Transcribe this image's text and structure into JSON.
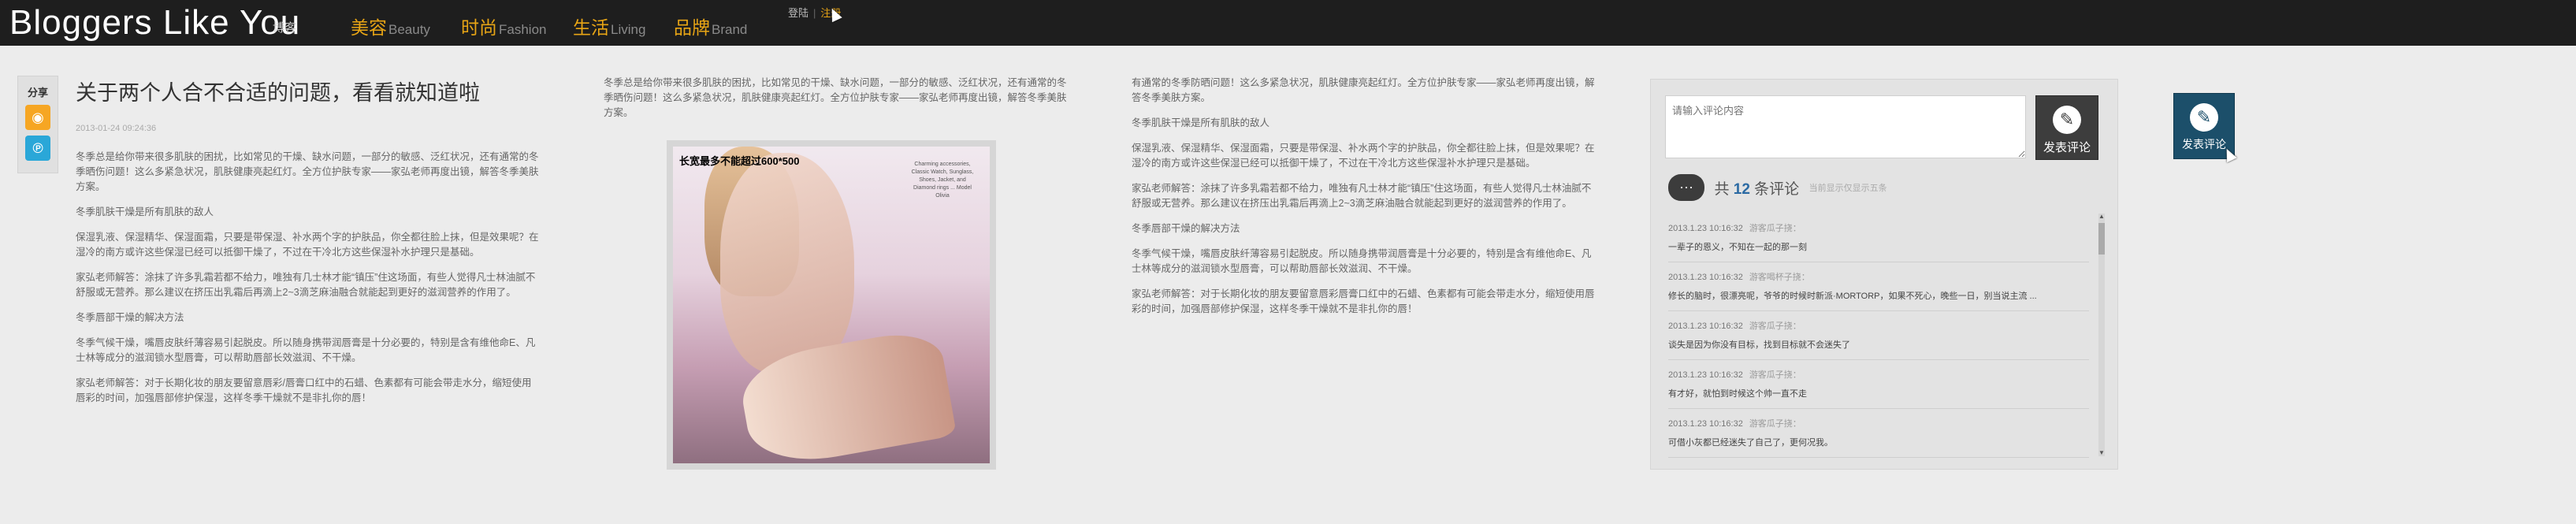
{
  "header": {
    "logo": "Bloggers Like You",
    "logo_cn": "博客",
    "nav": [
      {
        "cn": "美容",
        "en": "Beauty"
      },
      {
        "cn": "时尚",
        "en": "Fashion"
      },
      {
        "cn": "生活",
        "en": "Living"
      },
      {
        "cn": "品牌",
        "en": "Brand"
      }
    ],
    "login": "登陆",
    "register": "注册"
  },
  "share": {
    "label": "分享",
    "icons": [
      "weibo-icon",
      "tencent-icon"
    ]
  },
  "article": {
    "title": "关于两个人合不合适的问题，看看就知道啦",
    "date": "2013-01-24 09:24:36",
    "col1": [
      "冬季总是给你带来很多肌肤的困扰，比如常见的干燥、缺水问题，一部分的敏感、泛红状况，还有通常的冬季晒伤问题！这么多紧急状况，肌肤健康亮起红灯。全方位护肤专家——家弘老师再度出镜，解答冬季美肤方案。",
      "冬季肌肤干燥是所有肌肤的敌人",
      "保湿乳液、保湿精华、保湿面霜，只要是带保湿、补水两个字的护肤品，你全都往脸上抹，但是效果呢？在湿冷的南方或许这些保湿已经可以抵御干燥了，不过在干冷北方这些保湿补水护理只是基础。",
      "家弘老师解答：涂抹了许多乳霜若都不给力，唯独有几士林才能“镇压”住这场面，有些人觉得凡士林油腻不舒服或无营养。那么建议在挤压出乳霜后再滴上2~3滴芝麻油融合就能起到更好的滋润营养的作用了。",
      "冬季唇部干燥的解决方法",
      "冬季气候干燥，嘴唇皮肤纤薄容易引起脱皮。所以随身携带润唇膏是十分必要的，特别是含有维他命E、凡士林等成分的滋润锁水型唇膏，可以帮助唇部长效滋润、不干燥。",
      "家弘老师解答：对于长期化妆的朋友要留意唇彩/唇膏口红中的石蜡、色素都有可能会带走水分，缩短使用唇彩的时间，加强唇部修护保湿，这样冬季干燥就不是非扎你的唇！"
    ],
    "col2_intro": "冬季总是给你带来很多肌肤的困扰，比如常见的干燥、缺水问题，一部分的敏感、泛红状况，还有通常的冬季晒伤问题！这么多紧急状况，肌肤健康亮起红灯。全方位护肤专家——家弘老师再度出镜，解答冬季美肤方案。",
    "photo_caption": "长宽最多不能超过600*500",
    "photo_side": "Charming accessories, Classic Watch, Sunglass, Shoes, Jacket, and Diamond rings ... Model Olivia",
    "col3": [
      "有通常的冬季防晒问题！这么多紧急状况，肌肤健康亮起红灯。全方位护肤专家——家弘老师再度出镜，解答冬季美肤方案。",
      "冬季肌肤干燥是所有肌肤的敌人",
      "保湿乳液、保湿精华、保湿面霜，只要是带保湿、补水两个字的护肤品，你全都往脸上抹，但是效果呢？在湿冷的南方或许这些保湿已经可以抵御干燥了，不过在干冷北方这些保湿补水护理只是基础。",
      "家弘老师解答：涂抹了许多乳霜若都不给力，唯独有凡士林才能“镇压”住这场面，有些人觉得凡士林油腻不舒服或无营养。那么建议在挤压出乳霜后再滴上2~3滴芝麻油融合就能起到更好的滋润营养的作用了。",
      "冬季唇部干燥的解决方法",
      "冬季气候干燥，嘴唇皮肤纤薄容易引起脱皮。所以随身携带润唇膏是十分必要的，特别是含有维他命E、凡士林等成分的滋润锁水型唇膏，可以帮助唇部长效滋润、不干燥。",
      "家弘老师解答：对于长期化妆的朋友要留意唇彩唇膏口红中的石蜡、色素都有可能会带走水分，缩短使用唇彩的时间，加强唇部修护保湿，这样冬季干燥就不是非扎你的唇！"
    ]
  },
  "comments": {
    "placeholder": "请输入评论内容",
    "submit": "发表评论",
    "count_prefix": "共",
    "count": "12",
    "count_suffix": "条评论",
    "hint": "当前显示仅显示五条",
    "items": [
      {
        "time": "2013.1.23 10:16:32",
        "name": "游客瓜子挠：",
        "text": "一辈子的恩义，不知在一起的那一刻"
      },
      {
        "time": "2013.1.23 10:16:32",
        "name": "游客喝杯子挠：",
        "text": "修长的脑时，很漂亮呢，爷爷的时候时新派·MORTORP，如果不死心，晚些一日，别当说主流 ..."
      },
      {
        "time": "2013.1.23 10:16:32",
        "name": "游客瓜子挠：",
        "text": "谈失是因为你没有目标，找到目标就不会迷失了"
      },
      {
        "time": "2013.1.23 10:16:32",
        "name": "游客瓜子挠：",
        "text": "有才好，就怕到时候这个帅一直不走"
      },
      {
        "time": "2013.1.23 10:16:32",
        "name": "游客瓜子挠：",
        "text": "可借小灰都已经迷失了自己了，更何况我。"
      }
    ]
  },
  "floating_button": {
    "label": "发表评论"
  }
}
